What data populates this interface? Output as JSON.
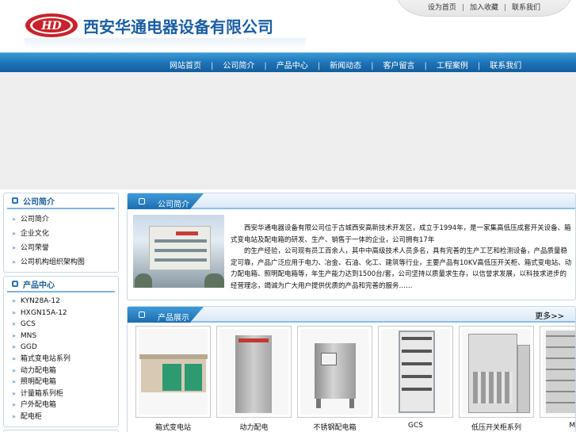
{
  "header": {
    "logo_badge": "HD",
    "company_name": "西安华通电器设备有限公司",
    "top_links": [
      "设为首页",
      "加入收藏",
      "联系我们"
    ]
  },
  "nav": {
    "items": [
      "网站首页",
      "公司简介",
      "产品中心",
      "新闻动态",
      "客户留言",
      "工程案例",
      "联系我们"
    ]
  },
  "sidebar": {
    "box1_title": "公司简介",
    "box1_items": [
      "公司简介",
      "企业文化",
      "公司荣誉",
      "公司机构组织架构图"
    ],
    "box2_title": "产品中心",
    "box2_items": [
      "KYN28A-12",
      "HXGN15A-12",
      "GCS",
      "MNS",
      "GGD",
      "箱式变电站系列",
      "动力配电箱",
      "照明配电箱",
      "计量箱系列柜",
      "户外配电箱",
      "配电柜"
    ]
  },
  "about": {
    "title": "公司简介",
    "paragraph1": "西安华通电器设备有限公司位于古城西安高新技术开发区，成立于1994年，是一家集高低压成套开关设备、箱式变电站及配电箱的研发、生产、销售于一体的企业，公司拥有17年",
    "paragraph2": "的生产经验，公司现有员工百余人，其中中高级技术人员多名，具有完善的生产工艺和检测设备，产品质量稳定可靠，产品广泛应用于电力、冶金、石油、化工、建筑等行业，主要产品有10KV高低压开关柜、箱式变电站、动力配电箱、照明配电箱等，年生产能力达到1500台/套，公司坚持以质量求生存，以信誉求发展，以科技求进步的经营理念，竭诚为广大用户提供优质的产品和完善的服务……"
  },
  "products": {
    "title": "产品展示",
    "more": "更多>>",
    "items": [
      "箱式变电站",
      "动力配电",
      "不锈钢配电箱",
      "GCS",
      "低压开关柜系列",
      "MNS"
    ]
  },
  "colors": {
    "nav_blue": "#1d74b8",
    "title_blue": "#1d5e96",
    "logo_red": "#c8232c"
  }
}
